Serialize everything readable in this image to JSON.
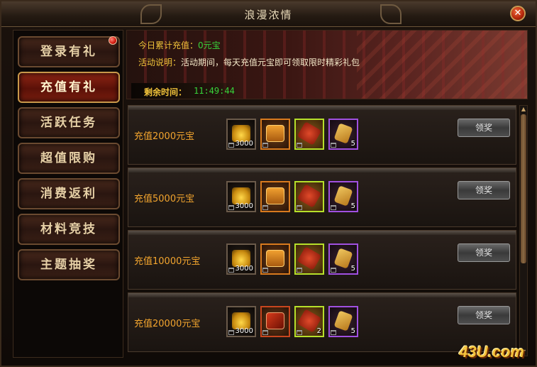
{
  "window": {
    "title": "浪漫浓情",
    "close_glyph": "✕"
  },
  "sidebar": {
    "items": [
      {
        "label": "登录有礼",
        "active": false,
        "has_notice": true
      },
      {
        "label": "充值有礼",
        "active": true,
        "has_notice": false
      },
      {
        "label": "活跃任务",
        "active": false,
        "has_notice": false
      },
      {
        "label": "超值限购",
        "active": false,
        "has_notice": false
      },
      {
        "label": "消费返利",
        "active": false,
        "has_notice": false
      },
      {
        "label": "材料竞技",
        "active": false,
        "has_notice": false
      },
      {
        "label": "主题抽奖",
        "active": false,
        "has_notice": false
      }
    ]
  },
  "banner": {
    "today_label": "今日累计充值：",
    "today_value": "0元宝",
    "desc_label": "活动说明：",
    "desc_text": "活动期间，每天充值元宝即可领取限时精彩礼包",
    "timer_label": "剩余时间：",
    "timer_value": "11:49:44"
  },
  "rewards": [
    {
      "label": "充值2000元宝",
      "button": "领奖",
      "items": [
        {
          "icon": "gold-ingot-icon",
          "count": "3000",
          "frame": "gold"
        },
        {
          "icon": "scroll-icon",
          "count": "",
          "frame": "orange"
        },
        {
          "icon": "red-pouch-icon",
          "count": "",
          "frame": "green"
        },
        {
          "icon": "amulet-icon",
          "count": "5",
          "frame": "purple"
        }
      ]
    },
    {
      "label": "充值5000元宝",
      "button": "领奖",
      "items": [
        {
          "icon": "gold-ingot-icon",
          "count": "3000",
          "frame": "gold"
        },
        {
          "icon": "scroll-icon",
          "count": "",
          "frame": "orange"
        },
        {
          "icon": "red-pouch-icon",
          "count": "",
          "frame": "green"
        },
        {
          "icon": "amulet-icon",
          "count": "5",
          "frame": "purple"
        }
      ]
    },
    {
      "label": "充值10000元宝",
      "button": "领奖",
      "items": [
        {
          "icon": "gold-ingot-icon",
          "count": "3000",
          "frame": "gold"
        },
        {
          "icon": "scroll-icon",
          "count": "",
          "frame": "orange"
        },
        {
          "icon": "red-pouch-icon",
          "count": "",
          "frame": "green"
        },
        {
          "icon": "amulet-icon",
          "count": "5",
          "frame": "purple"
        }
      ]
    },
    {
      "label": "充值20000元宝",
      "button": "领奖",
      "items": [
        {
          "icon": "gold-ingot-icon",
          "count": "3000",
          "frame": "gold"
        },
        {
          "icon": "red-book-icon",
          "count": "",
          "frame": "orange"
        },
        {
          "icon": "red-pouch-icon",
          "count": "2",
          "frame": "green"
        },
        {
          "icon": "amulet-icon",
          "count": "5",
          "frame": "purple"
        }
      ]
    }
  ],
  "watermark": "43U.com",
  "colors": {
    "accent_gold": "#f0c23a",
    "timer_green": "#38d43a",
    "row_label": "#f3a52e",
    "active_tab": "#8e2514"
  }
}
